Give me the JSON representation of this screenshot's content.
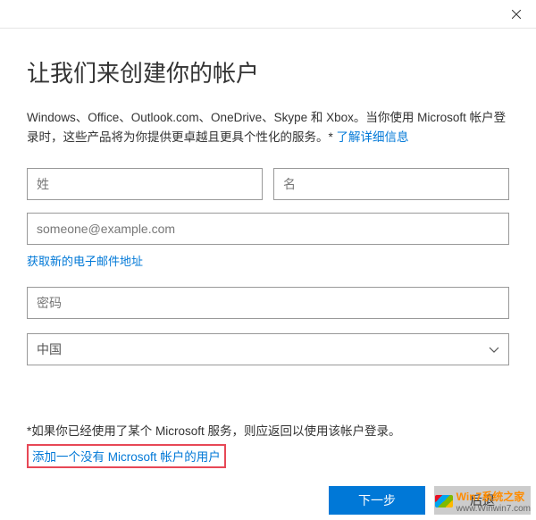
{
  "titlebar": {
    "close_icon": "close"
  },
  "heading": "让我们来创建你的帐户",
  "intro": {
    "text": "Windows、Office、Outlook.com、OneDrive、Skype 和 Xbox。当你使用 Microsoft 帐户登录时，这些产品将为你提供更卓越且更具个性化的服务。* ",
    "link": "了解详细信息"
  },
  "fields": {
    "lastname_placeholder": "姓",
    "firstname_placeholder": "名",
    "email_placeholder": "someone@example.com",
    "email_link": "获取新的电子邮件地址",
    "password_placeholder": "密码",
    "country_value": "中国"
  },
  "existing_note": "*如果你已经使用了某个 Microsoft 服务，则应返回以使用该帐户登录。",
  "add_user_link": "添加一个没有 Microsoft 帐户的用户",
  "buttons": {
    "next": "下一步",
    "back": "后退"
  },
  "watermark": {
    "line1": "Win7系统之家",
    "line2": "www.Winwin7.com"
  }
}
